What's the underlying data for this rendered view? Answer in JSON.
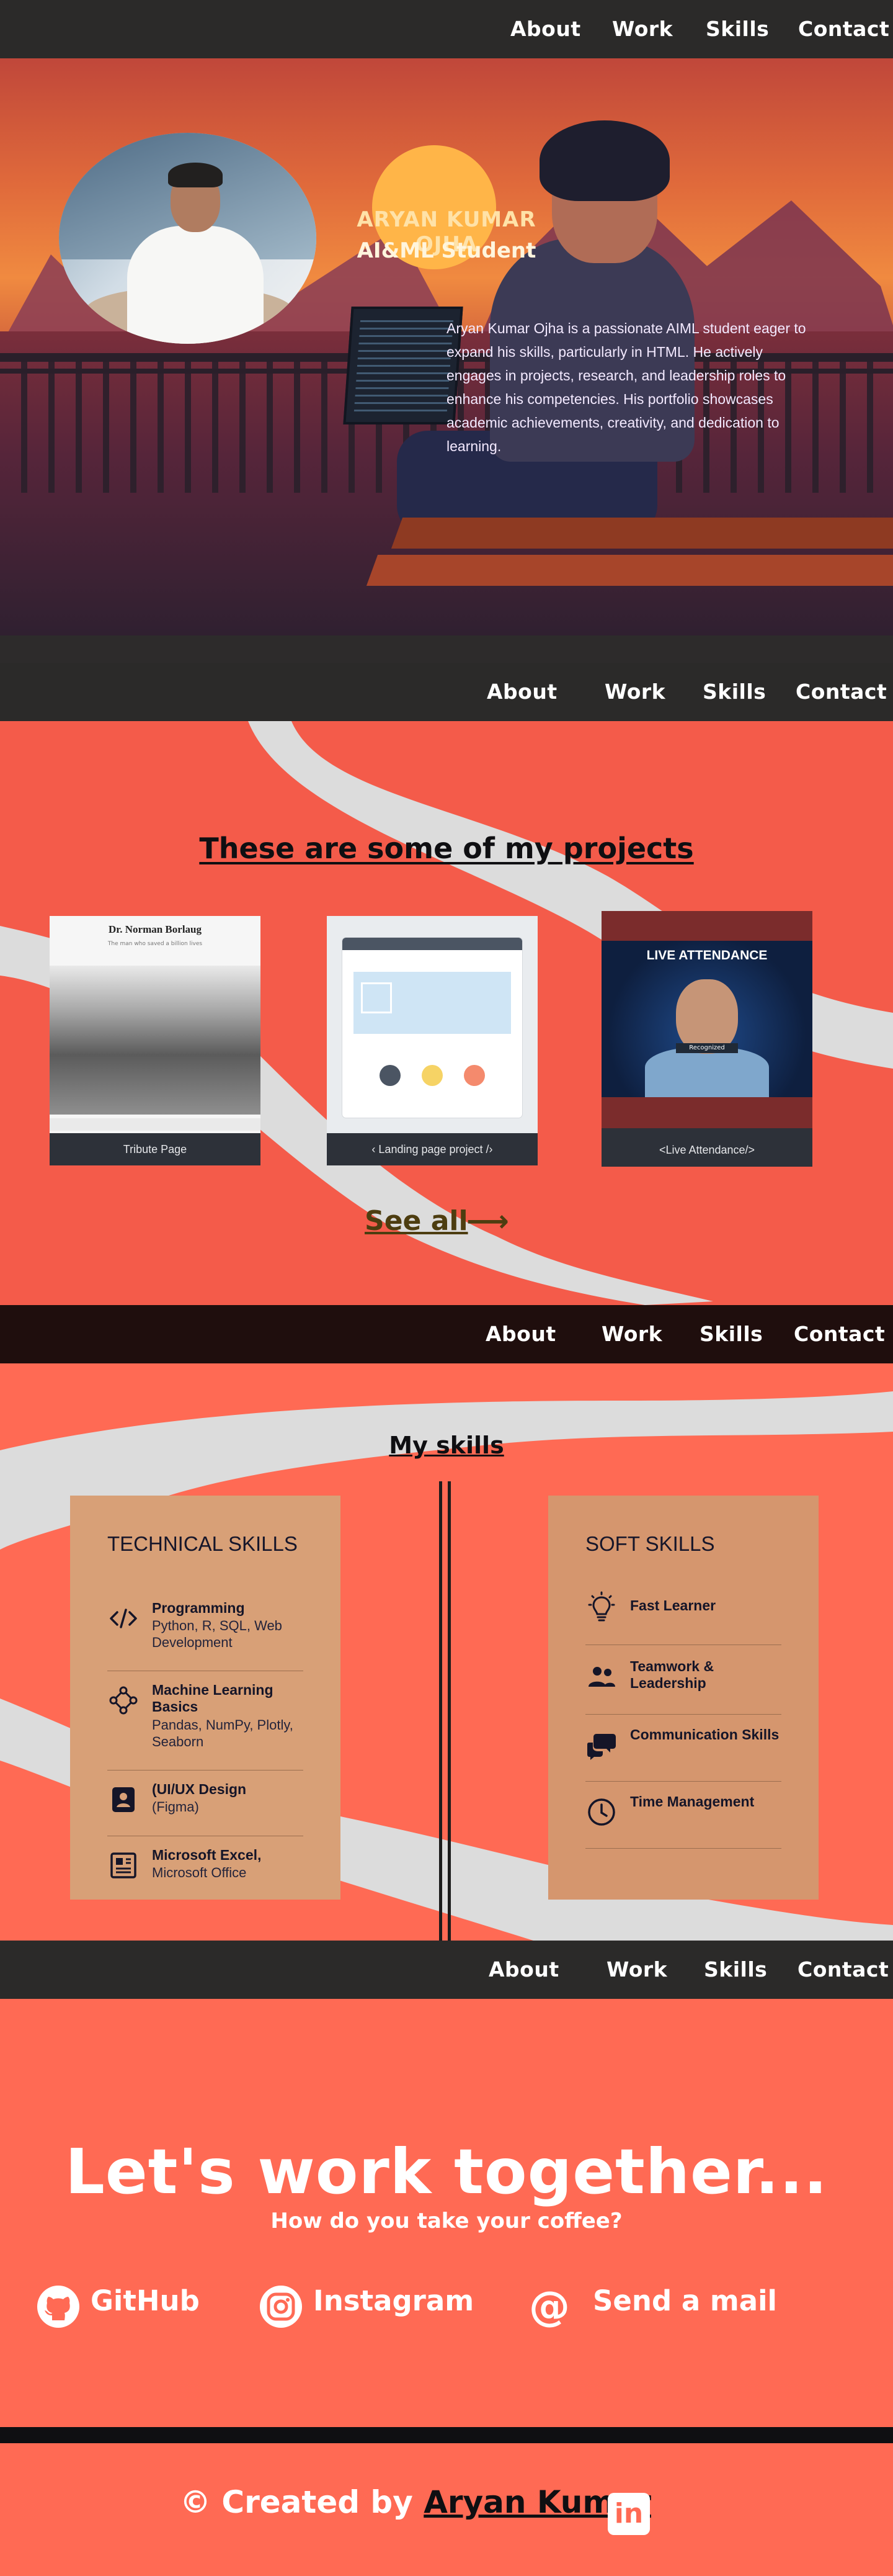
{
  "nav": {
    "about": "About",
    "work": "Work",
    "skills": "Skills",
    "contact": "Contact"
  },
  "hero": {
    "name": "ARYAN KUMAR OJHA",
    "role": "AI&ML Student",
    "bio": "Aryan Kumar Ojha is a passionate AIML student eager to expand his skills, particularly in HTML. He actively engages in projects, research, and leadership roles to enhance his competencies. His portfolio showcases academic achievements, creativity, and dedication to learning."
  },
  "projects": {
    "title": "These are some of my projects",
    "cards": [
      {
        "caption": "Tribute Page",
        "thumb_title": "Dr. Norman Borlaug",
        "thumb_sub": "The man who saved a billion lives"
      },
      {
        "caption": "‹ Landing page project /›"
      },
      {
        "caption": "<Live Attendance/>",
        "thumb_title": "LIVE ATTENDANCE",
        "thumb_tag": "Recognized"
      }
    ],
    "see_all": "See all",
    "see_all_arrow": "⟶"
  },
  "skills": {
    "title": "My skills",
    "technical": {
      "heading": "TECHNICAL SKILLS",
      "items": [
        {
          "title": "Programming",
          "desc": "Python, R, SQL, Web Development",
          "icon": "code-icon"
        },
        {
          "title": "Machine Learning Basics",
          "desc": "Pandas, NumPy, Plotly, Seaborn",
          "icon": "network-icon"
        },
        {
          "title": "(UI/UX Design",
          "desc": "(Figma)",
          "icon": "user-card-icon"
        },
        {
          "title": "Microsoft Excel,",
          "desc": "Microsoft Office",
          "icon": "document-icon"
        }
      ]
    },
    "soft": {
      "heading": "SOFT SKILLS",
      "items": [
        {
          "title": "Fast Learner",
          "icon": "lightbulb-icon"
        },
        {
          "title": "Teamwork & Leadership",
          "icon": "people-icon"
        },
        {
          "title": "Communication Skills",
          "icon": "chat-icon"
        },
        {
          "title": "Time Management",
          "icon": "clock-icon"
        }
      ]
    }
  },
  "contact": {
    "headline": "Let's work together...",
    "subtitle": "How do you take your coffee?",
    "links": [
      {
        "label": "GitHub",
        "icon": "github-icon"
      },
      {
        "label": "Instagram",
        "icon": "instagram-icon"
      },
      {
        "label": "Send a mail",
        "icon": "at-icon"
      }
    ]
  },
  "footer": {
    "prefix": "© Created by ",
    "name": "Aryan Kumar",
    "linkedin": "in"
  },
  "colors": {
    "nav": "#2b2a29",
    "accent": "#f45b4a",
    "panel": "#d8a077"
  }
}
